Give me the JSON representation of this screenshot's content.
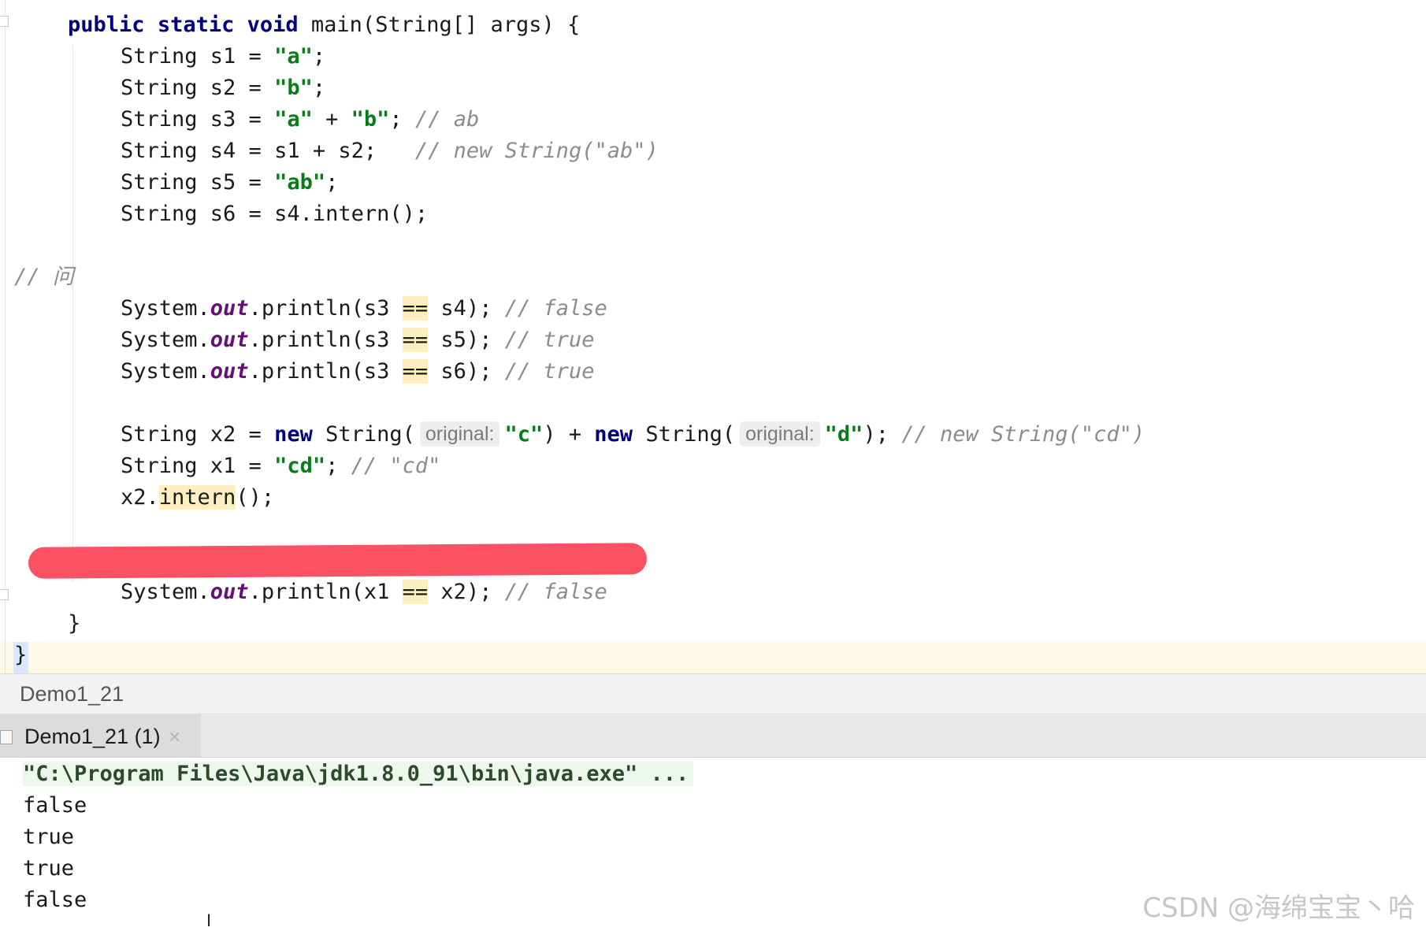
{
  "editor": {
    "lines": {
      "l0": [
        "public",
        " ",
        "static",
        " ",
        "void",
        " main(String[] args) {"
      ],
      "l1": [
        "String s1 = ",
        "\"a\"",
        ";"
      ],
      "l2": [
        "String s2 = ",
        "\"b\"",
        ";"
      ],
      "l3": [
        "String s3 = ",
        "\"a\"",
        " + ",
        "\"b\"",
        "; ",
        "// ab"
      ],
      "l4": [
        "String s4 = s1 + s2;   ",
        "// new String(\"ab\")"
      ],
      "l5": [
        "String s5 = ",
        "\"ab\"",
        ";"
      ],
      "l6": [
        "String s6 = s4.intern();"
      ],
      "l7": [
        "// 问"
      ],
      "l8": [
        "System.",
        "out",
        ".println(s3 ",
        "==",
        " s4); ",
        "// false"
      ],
      "l9": [
        "System.",
        "out",
        ".println(s3 ",
        "==",
        " s5); ",
        "// true"
      ],
      "l10": [
        "System.",
        "out",
        ".println(s3 ",
        "==",
        " s6); ",
        "// true"
      ],
      "l11": [
        "String x2 = ",
        "new",
        " String(",
        "original:",
        "\"c\"",
        ") + ",
        "new",
        " String(",
        "original:",
        "\"d\"",
        "); ",
        "// new String(\"cd\")"
      ],
      "l12": [
        "String x1 = ",
        "\"cd\"",
        "; ",
        "// \"cd\""
      ],
      "l13": [
        "x2.",
        "intern",
        "();"
      ],
      "l14": [
        "System.",
        "out",
        ".println(x1 ",
        "==",
        " x2); ",
        "// false"
      ],
      "l15": [
        "}"
      ],
      "l16": [
        "}"
      ]
    }
  },
  "run_panel": {
    "title": "Demo1_21",
    "tab_label": "Demo1_21 (1)",
    "close_glyph": "×",
    "console": [
      "\"C:\\Program Files\\Java\\jdk1.8.0_91\\bin\\java.exe\" ...",
      "false",
      "true",
      "true",
      "false"
    ]
  },
  "watermark": "CSDN @海绵宝宝丶哈"
}
